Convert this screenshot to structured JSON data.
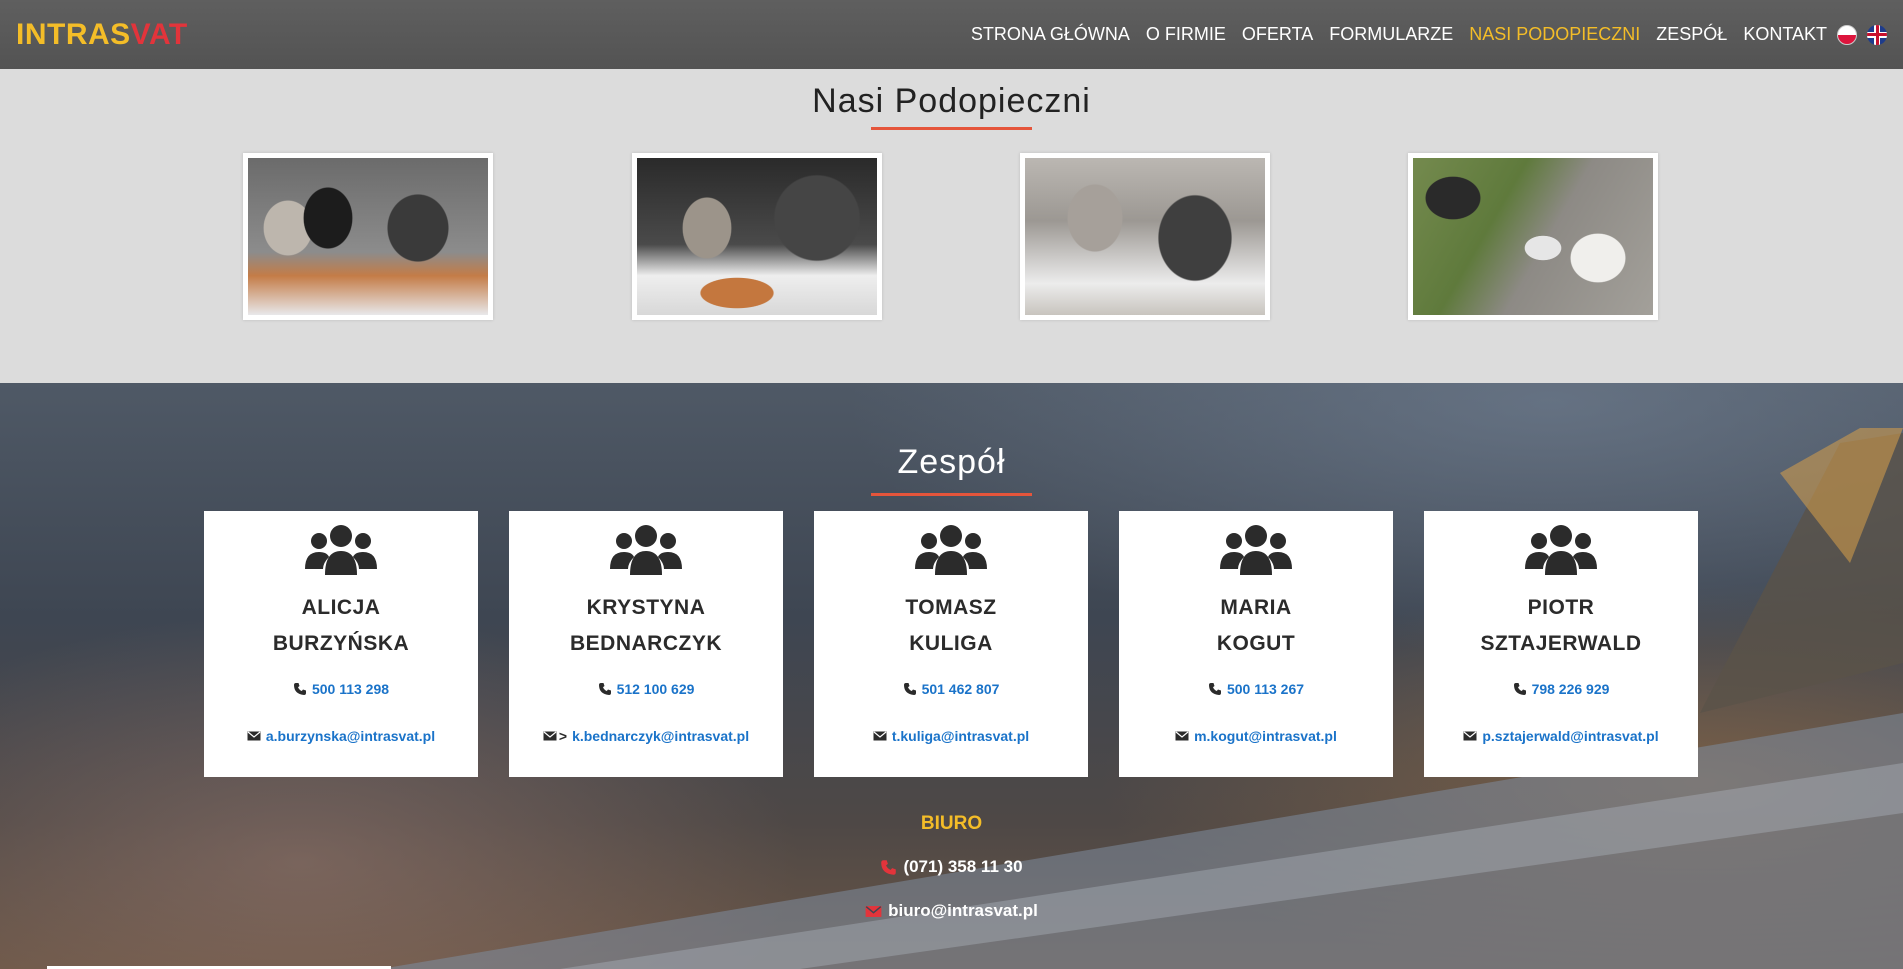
{
  "brand": {
    "part1": "INTRAS",
    "part2": "VAT"
  },
  "nav": {
    "items": [
      {
        "label": "STRONA GŁÓWNA",
        "active": false
      },
      {
        "label": "O FIRMIE",
        "active": false
      },
      {
        "label": "OFERTA",
        "active": false
      },
      {
        "label": "FORMULARZE",
        "active": false
      },
      {
        "label": "NASI PODOPIECZNI",
        "active": true
      },
      {
        "label": "ZESPÓŁ",
        "active": false
      },
      {
        "label": "KONTAKT",
        "active": false
      }
    ],
    "flags": [
      "flag-pl-icon",
      "flag-uk-icon"
    ]
  },
  "pets": {
    "title": "Nasi Podopieczni",
    "photos": [
      "cats-photo-1",
      "cats-photo-2",
      "cats-photo-3",
      "cats-photo-4"
    ]
  },
  "team": {
    "title": "Zespół",
    "members": [
      {
        "first": "ALICJA",
        "last": "BURZYŃSKA",
        "phone": "500 113 298",
        "email": "a.burzynska@intrasvat.pl",
        "email_prefix": ""
      },
      {
        "first": "KRYSTYNA",
        "last": "BEDNARCZYK",
        "phone": "512 100 629",
        "email": "k.bednarczyk@intrasvat.pl",
        "email_prefix": ">"
      },
      {
        "first": "TOMASZ",
        "last": "KULIGA",
        "phone": "501 462 807",
        "email": "t.kuliga@intrasvat.pl",
        "email_prefix": ""
      },
      {
        "first": "MARIA",
        "last": "KOGUT",
        "phone": "500 113 267",
        "email": "m.kogut@intrasvat.pl",
        "email_prefix": ""
      },
      {
        "first": "PIOTR",
        "last": "SZTAJERWALD",
        "phone": "798 226 929",
        "email": "p.sztajerwald@intrasvat.pl",
        "email_prefix": ""
      }
    ]
  },
  "office": {
    "title": "BIURO",
    "phone": "(071) 358 11 30",
    "email": "biuro@intrasvat.pl"
  },
  "colors": {
    "accent": "#f4bd28",
    "brand_red": "#e2343b",
    "link": "#1a73c9",
    "underline": "#e5553b"
  }
}
